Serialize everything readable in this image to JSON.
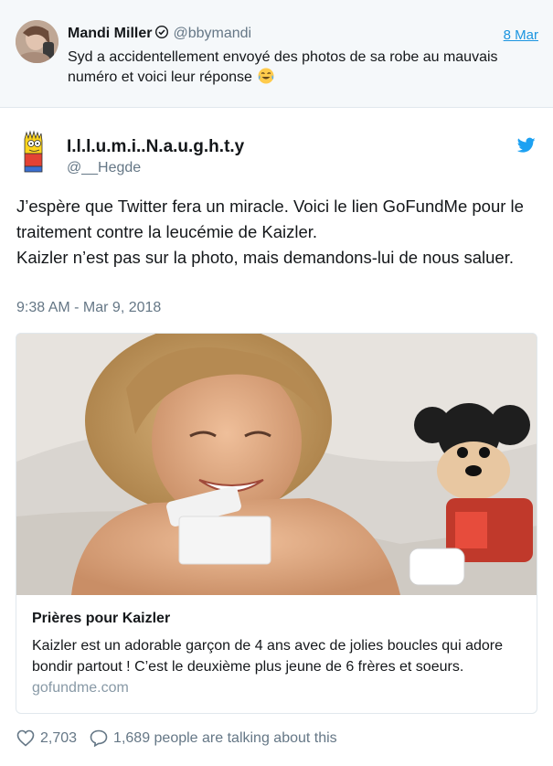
{
  "parent_tweet": {
    "name": "Mandi Miller",
    "handle": "@bbymandi",
    "date": "8 Mar",
    "text": "Syd a accidentellement envoyé des photos de sa robe au mauvais numéro et voici leur réponse",
    "emoji": "face-with-tears-of-joy",
    "verified_icon": "verified-badge-icon"
  },
  "tweet": {
    "name": "I.l.l.u.m.i..N.a.u.g.h.t.y",
    "handle": "@__Hegde",
    "text_line1": "J’espère que Twitter fera un miracle. Voici le lien GoFundMe pour le traitement contre la leucémie de Kaizler.",
    "text_line2": "Kaizler n’est pas sur la photo, mais demandons-lui de nous saluer.",
    "timestamp": "9:38 AM - Mar 9, 2018",
    "brand_icon": "twitter-bird-icon"
  },
  "link_card": {
    "title": "Prières pour Kaizler",
    "description": "Kaizler est un adorable garçon de 4 ans avec de jolies boucles qui adore bondir partout ! C’est le deuxième plus jeune de 6 frères et soeurs.",
    "domain": "gofundme.com"
  },
  "actions": {
    "likes": "2,703",
    "comments_text": "1,689 people are talking about this"
  },
  "colors": {
    "link_blue": "#1b95e0",
    "muted": "#657786",
    "twitter_blue": "#1da1f2",
    "parent_bg": "#f5f8fa"
  }
}
